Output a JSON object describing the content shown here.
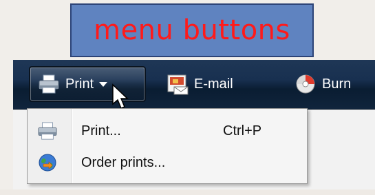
{
  "caption": {
    "text": "menu buttons"
  },
  "toolbar": {
    "print_label": "Print",
    "email_label": "E-mail",
    "burn_label": "Burn"
  },
  "print_menu": {
    "items": [
      {
        "label": "Print...",
        "shortcut": "Ctrl+P",
        "icon": "printer-icon"
      },
      {
        "label": "Order prints...",
        "shortcut": "",
        "icon": "globe-icon"
      }
    ]
  },
  "colors": {
    "caption_bg": "#5f83c0",
    "caption_text": "#ff1a1a",
    "toolbar_bg": "#183050",
    "menu_bg": "#f5f5f5"
  }
}
